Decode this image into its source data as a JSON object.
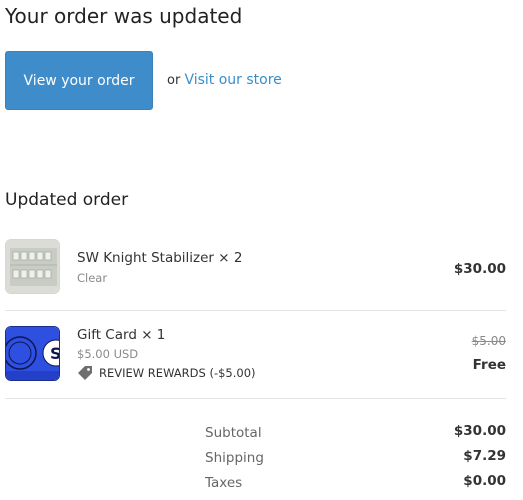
{
  "header": {
    "title": "Your order was updated"
  },
  "actions": {
    "view_order_label": "View your order",
    "or_text": "or",
    "visit_store_label": "Visit our store"
  },
  "order": {
    "section_title": "Updated order",
    "items": [
      {
        "name": "SW Knight Stabilizer",
        "qty_text": "× 2",
        "variant": "Clear",
        "price": "$30.00",
        "thumbnail_icon": "stabilizer-product-photo"
      },
      {
        "name": "Gift Card",
        "qty_text": "× 1",
        "variant": "$5.00 USD",
        "discount_label": "REVIEW REWARDS (-$5.00)",
        "original_price": "$5.00",
        "price": "Free",
        "thumbnail_icon": "gift-card-photo"
      }
    ]
  },
  "totals": {
    "subtotal_label": "Subtotal",
    "subtotal_value": "$30.00",
    "shipping_label": "Shipping",
    "shipping_value": "$7.29",
    "taxes_label": "Taxes",
    "taxes_value": "$0.00"
  },
  "colors": {
    "accent": "#3f8ccb",
    "link": "#3a8ec9",
    "text": "#333333",
    "muted": "#8a8a8a"
  }
}
